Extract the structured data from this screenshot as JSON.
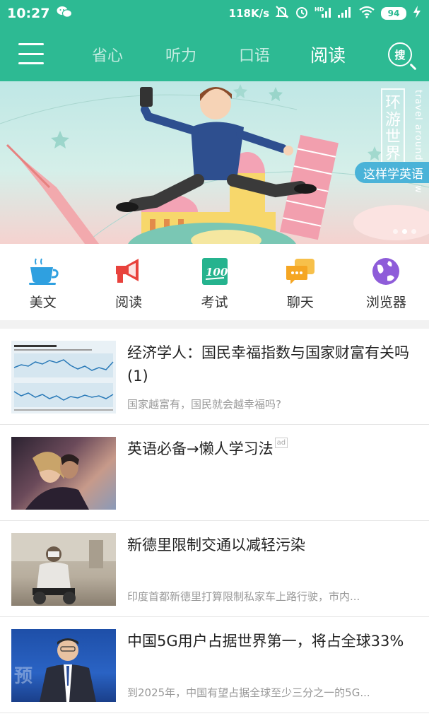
{
  "status_bar": {
    "time": "10:27",
    "network_speed": "118K/s",
    "battery": "94",
    "icons": [
      "wechat-icon",
      "mute-icon",
      "alarm-icon",
      "hd-signal-icon",
      "signal-icon",
      "wifi-icon",
      "battery-icon",
      "charging-icon"
    ]
  },
  "nav": {
    "tabs": [
      {
        "label": "省心"
      },
      {
        "label": "听力"
      },
      {
        "label": "口语"
      },
      {
        "label": "阅读"
      }
    ],
    "active_tab": "阅读",
    "search_label": "搜"
  },
  "banner": {
    "vertical_title": "环游世界",
    "vertical_sub": "travel around the w",
    "tag": "这样学英语"
  },
  "categories": [
    {
      "label": "美文",
      "icon": "teacup-icon",
      "color": "#2fa0e0"
    },
    {
      "label": "阅读",
      "icon": "megaphone-icon",
      "color": "#e8423c"
    },
    {
      "label": "考试",
      "icon": "score-100-icon",
      "color": "#25b38e"
    },
    {
      "label": "聊天",
      "icon": "chat-bubbles-icon",
      "color": "#f5a623"
    },
    {
      "label": "浏览器",
      "icon": "globe-icon",
      "color": "#8e5cd9"
    }
  ],
  "articles": [
    {
      "title": "经济学人：国民幸福指数与国家财富有关吗(1)",
      "desc": "国家越富有，国民就会越幸福吗?",
      "ad": false
    },
    {
      "title": "英语必备→懒人学习法",
      "desc": "",
      "ad": true,
      "ad_label": "ad"
    },
    {
      "title": "新德里限制交通以减轻污染",
      "desc": "印度首都新德里打算限制私家车上路行驶，市内...",
      "ad": false
    },
    {
      "title": "中国5G用户占据世界第一，将占全球33%",
      "desc": "到2025年，中国有望占据全球至少三分之一的5G...",
      "ad": false
    }
  ]
}
